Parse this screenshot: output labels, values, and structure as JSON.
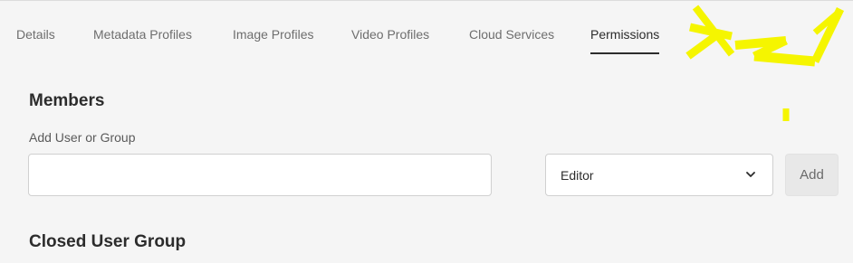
{
  "tabs": [
    {
      "label": "Details",
      "active": false
    },
    {
      "label": "Metadata Profiles",
      "active": false
    },
    {
      "label": "Image Profiles",
      "active": false
    },
    {
      "label": "Video Profiles",
      "active": false
    },
    {
      "label": "Cloud Services",
      "active": false
    },
    {
      "label": "Permissions",
      "active": true
    }
  ],
  "members": {
    "heading": "Members",
    "field_label": "Add User or Group",
    "input_value": "",
    "role_selected": "Editor",
    "add_label": "Add"
  },
  "closed_user_group": {
    "heading": "Closed User Group"
  },
  "annotation": {
    "color": "#f5f500",
    "icon": "yellow-scribble-mark"
  }
}
